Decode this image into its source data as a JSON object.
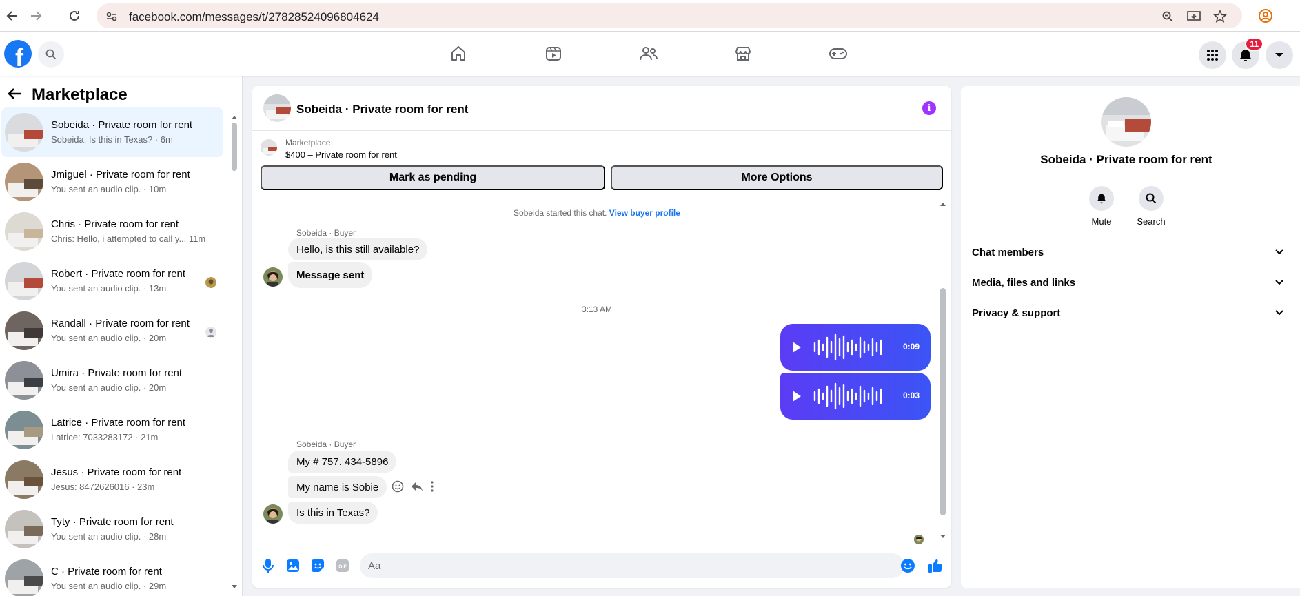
{
  "browser": {
    "url": "facebook.com/messages/t/27828524096804624"
  },
  "fbnav": {
    "notification_count": "11"
  },
  "sidebar": {
    "title": "Marketplace",
    "conversations": [
      {
        "name": "Sobeida · Private room for rent",
        "preview": "Sobeida: Is this in Texas? · 6m",
        "active": true
      },
      {
        "name": "Jmiguel · Private room for rent",
        "preview": "You sent an audio clip. · 10m"
      },
      {
        "name": "Chris · Private room for rent",
        "preview": "Chris: Hello, i attempted to call y...   11m"
      },
      {
        "name": "Robert · Private room for rent",
        "preview": "You sent an audio clip. · 13m"
      },
      {
        "name": "Randall · Private room for rent",
        "preview": "You sent an audio clip. · 20m"
      },
      {
        "name": "Umira · Private room for rent",
        "preview": "You sent an audio clip. · 20m"
      },
      {
        "name": "Latrice · Private room for rent",
        "preview": "Latrice: 7033283172 · 21m"
      },
      {
        "name": "Jesus · Private room for rent",
        "preview": "Jesus: 8472626016 · 23m"
      },
      {
        "name": "Tyty · Private room for rent",
        "preview": "You sent an audio clip. · 28m"
      },
      {
        "name": "C · Private room for rent",
        "preview": "You sent an audio clip. · 29m"
      }
    ]
  },
  "chat": {
    "header_name": "Sobeida · Private room for rent",
    "listing": {
      "label": "Marketplace",
      "title": "$400 – Private room for rent",
      "mark_pending_label": "Mark as pending",
      "more_options_label": "More Options"
    },
    "system_text": "Sobeida started this chat.",
    "system_link": "View buyer profile",
    "sender_label_1": "Sobeida · Buyer",
    "msg_1": "Hello, is this still available?",
    "msg_2": "Message sent",
    "timestamp": "3:13 AM",
    "audio_1_duration": "0:09",
    "audio_2_duration": "0:03",
    "sender_label_2": "Sobeida · Buyer",
    "msg_3": "My # 757. 434-5896",
    "msg_4": "My name is Sobie",
    "msg_5": "Is this in Texas?",
    "composer_placeholder": "Aa"
  },
  "info_panel": {
    "name": "Sobeida · Private room for rent",
    "mute_label": "Mute",
    "search_label": "Search",
    "sections": [
      "Chat members",
      "Media, files and links",
      "Privacy & support"
    ]
  },
  "colors": {
    "facebook_blue": "#1877f2",
    "audio_gradient_start": "#5b3cf5",
    "audio_gradient_end": "#3b54f5",
    "info_purple": "#a033ff",
    "active_conversation_bg": "#ebf5ff",
    "notification_red": "#e41e3f"
  }
}
